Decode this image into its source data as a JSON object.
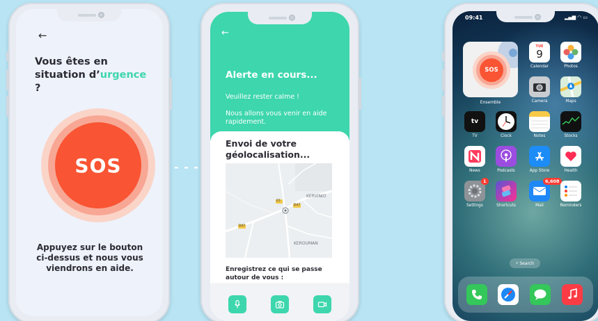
{
  "colors": {
    "accent": "#3dd6ad",
    "sos": "#f95433",
    "background": "#b8e4f4"
  },
  "screen1": {
    "back_icon": "←",
    "title_part1": "Vous êtes en situation d’",
    "title_highlight": "urgence",
    "title_part2": " ?",
    "sos_label": "SOS",
    "hint": "Appuyez sur le bouton ci-dessus et nous vous viendrons en aide."
  },
  "connector": "- - -",
  "screen2": {
    "back_icon": "←",
    "alert_title": "Alerte en cours...",
    "calm_text": "Veuillez rester calme !",
    "help_text": "Nous allons vous venir en aide rapidement.",
    "geo_title": "Envoi de votre géolocalisation...",
    "map_labels": {
      "kervinio": "KERVINIO",
      "kerouman": "KEROUMAN",
      "road1": "E5",
      "road2": "D47",
      "road3": "D47"
    },
    "record_text": "Enregistrez ce qui se passe autour de vous :",
    "actions": [
      {
        "name": "microphone",
        "icon": "microphone-icon"
      },
      {
        "name": "camera",
        "icon": "camera-icon"
      },
      {
        "name": "video",
        "icon": "video-camera-icon"
      }
    ]
  },
  "screen3": {
    "time": "09:41",
    "widget_sos": "SOS",
    "widget_label": "Ensemble",
    "calendar": {
      "day": "TUE",
      "date": "9"
    },
    "apps": [
      {
        "label": "Calendar"
      },
      {
        "label": "Photos"
      },
      {
        "label": "Camera"
      },
      {
        "label": "Maps"
      },
      {
        "label": "TV",
        "icon_text": "tv"
      },
      {
        "label": "Clock"
      },
      {
        "label": "Notes"
      },
      {
        "label": "Stocks"
      },
      {
        "label": "News"
      },
      {
        "label": "Podcasts"
      },
      {
        "label": "App Store"
      },
      {
        "label": "Health"
      },
      {
        "label": "Settings",
        "badge": "1"
      },
      {
        "label": "Shortcuts"
      },
      {
        "label": "Mail",
        "badge": "6,608"
      },
      {
        "label": "Reminders"
      }
    ],
    "search": "Search",
    "dock": [
      "phone-icon",
      "safari-icon",
      "messages-icon",
      "music-icon"
    ]
  }
}
